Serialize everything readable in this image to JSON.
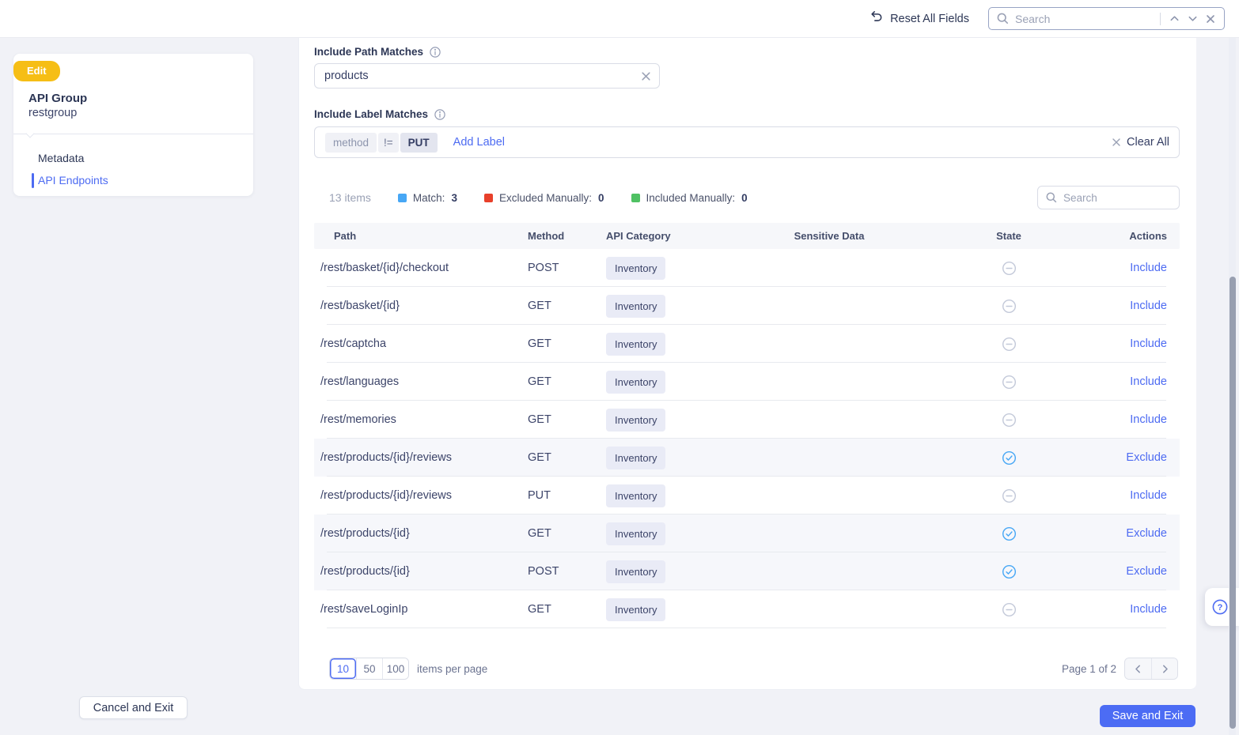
{
  "topbar": {
    "reset_label": "Reset All Fields",
    "search_placeholder": "Search"
  },
  "sidebar": {
    "badge": "Edit",
    "title": "API Group",
    "subtitle": "restgroup",
    "items": [
      {
        "label": "Metadata",
        "active": false
      },
      {
        "label": "API Endpoints",
        "active": true
      }
    ]
  },
  "filters": {
    "path_label": "Include Path Matches",
    "path_value": "products",
    "label_label": "Include Label Matches",
    "chip": {
      "key": "method",
      "operator": "!=",
      "value": "PUT"
    },
    "add_label": "Add Label",
    "clear_all": "Clear All"
  },
  "summary": {
    "items_count": "13 items",
    "legend": [
      {
        "label": "Match:",
        "value": "3",
        "color": "#47a7f5"
      },
      {
        "label": "Excluded Manually:",
        "value": "0",
        "color": "#e8402a"
      },
      {
        "label": "Included Manually:",
        "value": "0",
        "color": "#4fc163"
      }
    ],
    "search_placeholder": "Search"
  },
  "table": {
    "columns": [
      "Path",
      "Method",
      "API Category",
      "Sensitive Data",
      "State",
      "Actions"
    ],
    "rows": [
      {
        "path": "/rest/basket/{id}/checkout",
        "method": "POST",
        "category": "Inventory",
        "sensitive": "",
        "state": "none",
        "action": "Include",
        "highlighted": false
      },
      {
        "path": "/rest/basket/{id}",
        "method": "GET",
        "category": "Inventory",
        "sensitive": "",
        "state": "none",
        "action": "Include",
        "highlighted": false
      },
      {
        "path": "/rest/captcha",
        "method": "GET",
        "category": "Inventory",
        "sensitive": "",
        "state": "none",
        "action": "Include",
        "highlighted": false
      },
      {
        "path": "/rest/languages",
        "method": "GET",
        "category": "Inventory",
        "sensitive": "",
        "state": "none",
        "action": "Include",
        "highlighted": false
      },
      {
        "path": "/rest/memories",
        "method": "GET",
        "category": "Inventory",
        "sensitive": "",
        "state": "none",
        "action": "Include",
        "highlighted": false
      },
      {
        "path": "/rest/products/{id}/reviews",
        "method": "GET",
        "category": "Inventory",
        "sensitive": "",
        "state": "match",
        "action": "Exclude",
        "highlighted": true
      },
      {
        "path": "/rest/products/{id}/reviews",
        "method": "PUT",
        "category": "Inventory",
        "sensitive": "",
        "state": "none",
        "action": "Include",
        "highlighted": false
      },
      {
        "path": "/rest/products/{id}",
        "method": "GET",
        "category": "Inventory",
        "sensitive": "",
        "state": "match",
        "action": "Exclude",
        "highlighted": true
      },
      {
        "path": "/rest/products/{id}",
        "method": "POST",
        "category": "Inventory",
        "sensitive": "",
        "state": "match",
        "action": "Exclude",
        "highlighted": true
      },
      {
        "path": "/rest/saveLoginIp",
        "method": "GET",
        "category": "Inventory",
        "sensitive": "",
        "state": "none",
        "action": "Include",
        "highlighted": false
      }
    ]
  },
  "pagination": {
    "sizes": [
      "10",
      "50",
      "100"
    ],
    "selected_size": "10",
    "per_page_label": "items per page",
    "page_label": "Page 1 of 2"
  },
  "footer": {
    "cancel_label": "Cancel and Exit",
    "save_label": "Save and Exit"
  },
  "icons": {
    "reset": "undo-arrow",
    "search": "magnifier",
    "info": "circle-i",
    "clear": "x-mark",
    "state_none": "circle-minus",
    "state_match": "circle-check",
    "help": "circle-question"
  },
  "colors": {
    "accent_blue": "#4d6bf2",
    "match_blue": "#47a7f5",
    "excluded_red": "#e8402a",
    "included_green": "#4fc163",
    "edit_badge_yellow": "#f6be15",
    "state_minus_gray": "#c3c9d9",
    "save_button_blue": "#4c6cf4"
  }
}
